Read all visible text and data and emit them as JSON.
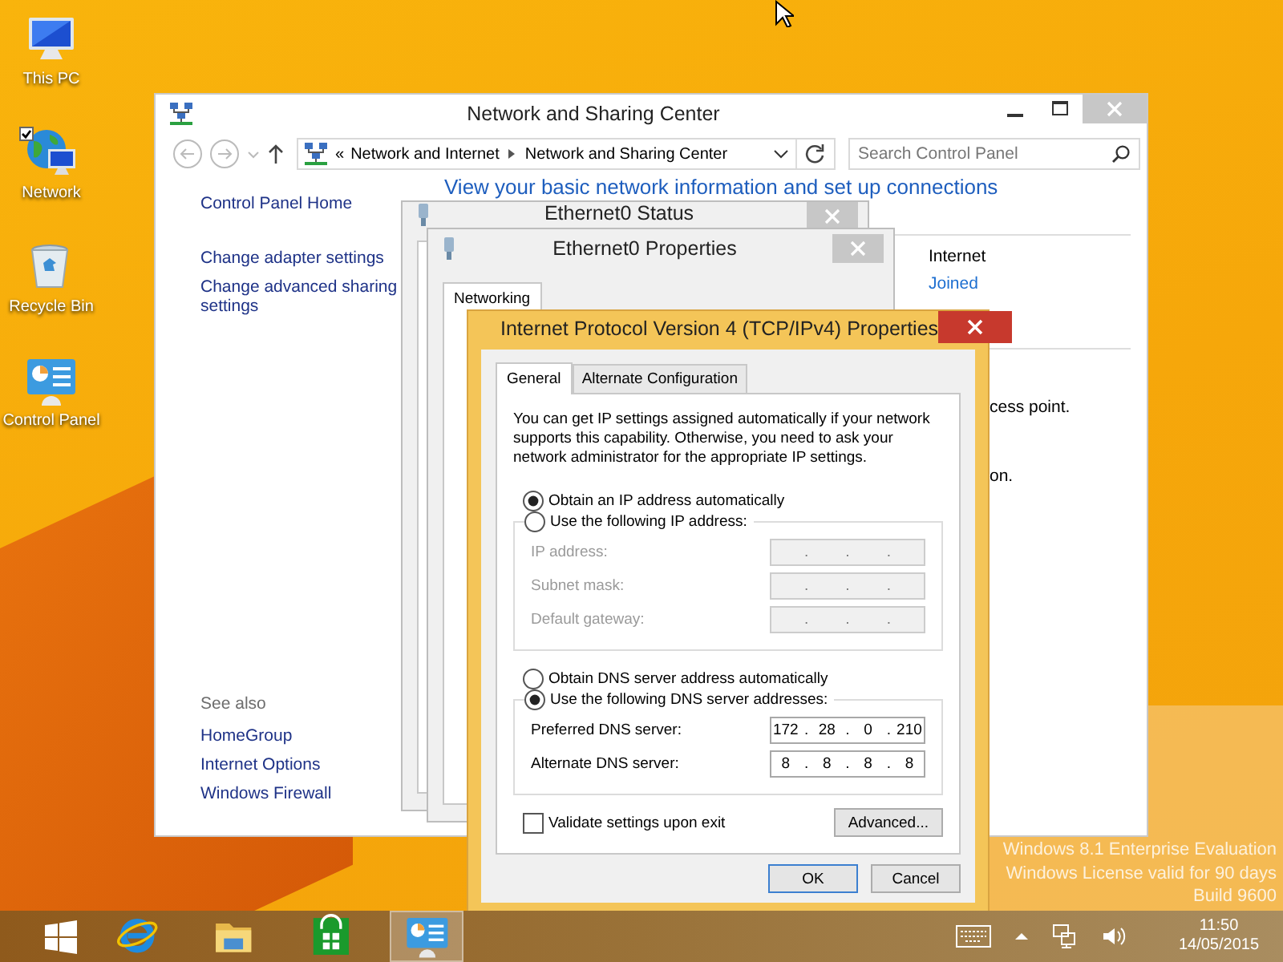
{
  "desktop_icons": [
    {
      "label": "This PC",
      "kind": "pc",
      "checked": false
    },
    {
      "label": "Network",
      "kind": "network",
      "checked": true
    },
    {
      "label": "Recycle Bin",
      "kind": "bin",
      "checked": false
    },
    {
      "label": "Control Panel",
      "kind": "panel",
      "checked": false
    }
  ],
  "network_window": {
    "title": "Network and Sharing Center",
    "breadcrumb": [
      "Network and Internet",
      "Network and Sharing Center"
    ],
    "breadcrumb_prefix": "«",
    "search": {
      "placeholder": "Search Control Panel"
    },
    "sidebar": {
      "items": [
        "Control Panel Home",
        "Change adapter settings",
        "Change advanced sharing settings"
      ],
      "see_also_heading": "See also",
      "see_also": [
        "HomeGroup",
        "Internet Options",
        "Windows Firewall"
      ]
    },
    "heading": "View your basic network information and set up connections",
    "details": [
      {
        "text": "Internet",
        "kind": "label"
      },
      {
        "text": "Joined",
        "kind": "link"
      }
    ],
    "fragments": [
      "cess point.",
      "on."
    ]
  },
  "status_window": {
    "title": "Ethernet0 Status"
  },
  "properties_window": {
    "title": "Ethernet0 Properties",
    "tabs": [
      {
        "label": "Networking",
        "selected": true
      }
    ]
  },
  "ipv4_dialog": {
    "title": "Internet Protocol Version 4 (TCP/IPv4) Properties",
    "tabs": [
      {
        "label": "General",
        "selected": true
      },
      {
        "label": "Alternate Configuration",
        "selected": false
      }
    ],
    "intro": "You can get IP settings assigned automatically if your network supports this capability. Otherwise, you need to ask your network administrator for the appropriate IP settings.",
    "separator": ".",
    "ip_options": [
      {
        "label": "Obtain an IP address automatically",
        "selected": true
      },
      {
        "label": "Use the following IP address:",
        "selected": false
      }
    ],
    "ip_fields": [
      {
        "label": "IP address:",
        "disabled": true
      },
      {
        "label": "Subnet mask:",
        "disabled": true
      },
      {
        "label": "Default gateway:",
        "disabled": true
      }
    ],
    "dns_options": [
      {
        "label": "Obtain DNS server address automatically",
        "selected": false
      },
      {
        "label": "Use the following DNS server addresses:",
        "selected": true
      }
    ],
    "dns_fields": [
      {
        "label": "Preferred DNS server:",
        "disabled": false,
        "octets": [
          "172",
          "28",
          "0",
          "210"
        ]
      },
      {
        "label": "Alternate DNS server:",
        "disabled": false,
        "octets": [
          "8",
          "8",
          "8",
          "8"
        ]
      }
    ],
    "validate": {
      "label": "Validate settings upon exit",
      "checked": false
    },
    "advanced_button": "Advanced...",
    "buttons": [
      {
        "label": "OK",
        "default": true
      },
      {
        "label": "Cancel",
        "default": false
      }
    ]
  },
  "watermark": [
    "Windows 8.1 Enterprise Evaluation",
    "Windows License valid for 90 days",
    "Build 9600"
  ],
  "taskbar": {
    "apps": [
      {
        "kind": "ie",
        "active": false
      },
      {
        "kind": "explorer",
        "active": false
      },
      {
        "kind": "store",
        "active": false
      },
      {
        "kind": "panel",
        "active": true
      }
    ],
    "clock": {
      "time": "11:50",
      "date": "14/05/2015"
    }
  }
}
